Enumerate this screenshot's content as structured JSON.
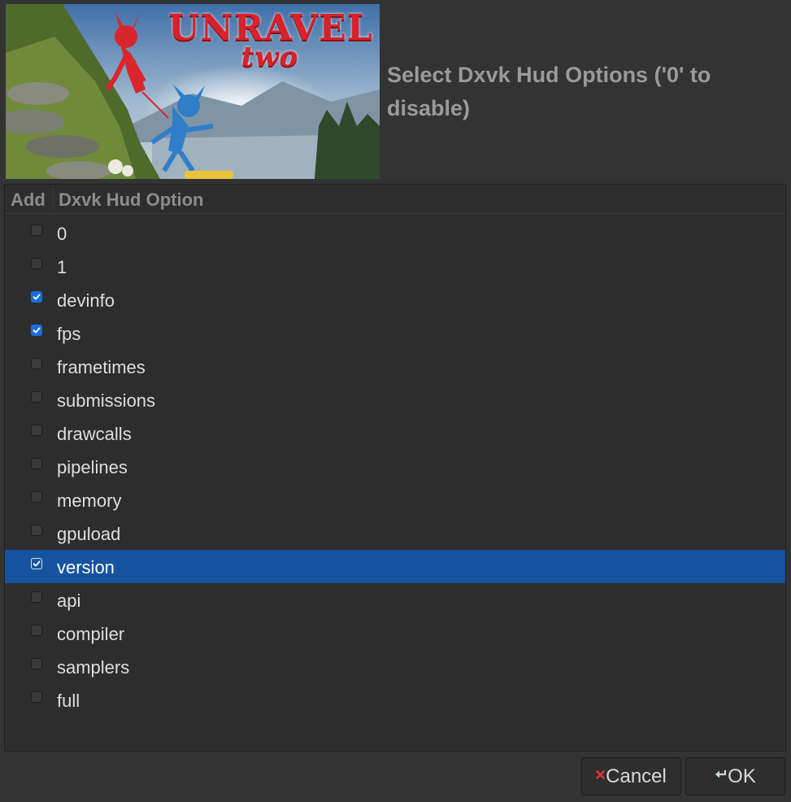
{
  "banner": {
    "logo_line1": "UNRAVEL",
    "logo_line2": "two"
  },
  "heading": "Select Dxvk Hud Options ('0' to disable)",
  "list": {
    "columns": [
      "Add",
      "Dxvk Hud Option"
    ],
    "rows": [
      {
        "label": "0",
        "checked": false,
        "selected": false
      },
      {
        "label": "1",
        "checked": false,
        "selected": false
      },
      {
        "label": "devinfo",
        "checked": true,
        "selected": false
      },
      {
        "label": "fps",
        "checked": true,
        "selected": false
      },
      {
        "label": "frametimes",
        "checked": false,
        "selected": false
      },
      {
        "label": "submissions",
        "checked": false,
        "selected": false
      },
      {
        "label": "drawcalls",
        "checked": false,
        "selected": false
      },
      {
        "label": "pipelines",
        "checked": false,
        "selected": false
      },
      {
        "label": "memory",
        "checked": false,
        "selected": false
      },
      {
        "label": "gpuload",
        "checked": false,
        "selected": false
      },
      {
        "label": "version",
        "checked": true,
        "selected": true
      },
      {
        "label": "api",
        "checked": false,
        "selected": false
      },
      {
        "label": "compiler",
        "checked": false,
        "selected": false
      },
      {
        "label": "samplers",
        "checked": false,
        "selected": false
      },
      {
        "label": "full",
        "checked": false,
        "selected": false
      }
    ]
  },
  "buttons": {
    "cancel_label": "Cancel",
    "ok_label": "OK",
    "cancel_icon": "close-icon",
    "ok_icon": "enter-return-icon"
  },
  "colors": {
    "selection": "#15539e",
    "checkbox_on": "#1a6ed8",
    "cancel_icon": "#e0333a"
  }
}
